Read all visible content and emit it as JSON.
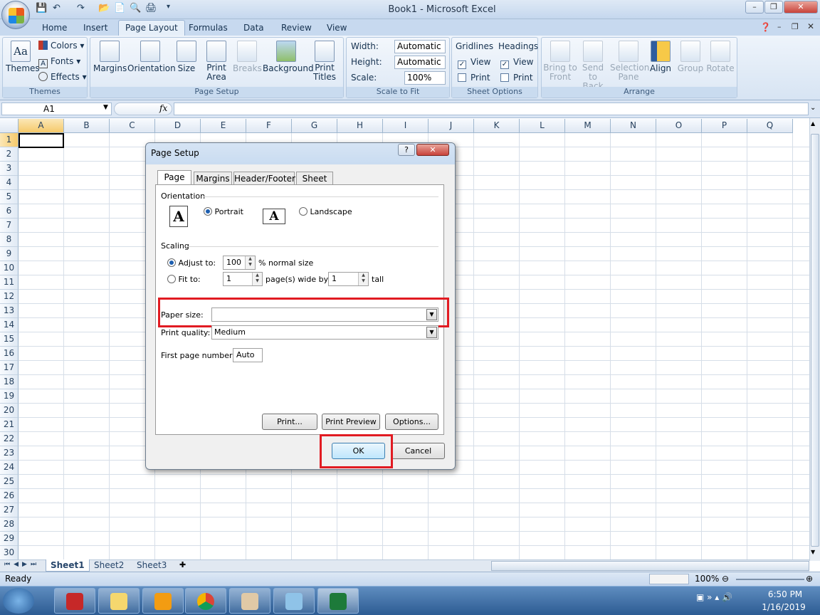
{
  "window": {
    "title": "Book1 - Microsoft Excel",
    "controls": {
      "minimize": "–",
      "restore": "❐",
      "close": "✕"
    }
  },
  "ribbon_tabs": [
    "Home",
    "Insert",
    "Page Layout",
    "Formulas",
    "Data",
    "Review",
    "View"
  ],
  "active_tab": "Page Layout",
  "ribbon": {
    "themes": {
      "themes_label": "Themes",
      "colors": "Colors",
      "fonts": "Fonts",
      "effects": "Effects",
      "group": "Themes"
    },
    "page_setup": {
      "margins": "Margins",
      "orientation": "Orientation",
      "size": "Size",
      "print_area_1": "Print",
      "print_area_2": "Area",
      "breaks": "Breaks",
      "background": "Background",
      "print_titles_1": "Print",
      "print_titles_2": "Titles",
      "group": "Page Setup"
    },
    "scale_to_fit": {
      "width_label": "Width:",
      "width_value": "Automatic",
      "height_label": "Height:",
      "height_value": "Automatic",
      "scale_label": "Scale:",
      "scale_value": "100%",
      "group": "Scale to Fit"
    },
    "sheet_options": {
      "gridlines": "Gridlines",
      "headings": "Headings",
      "view": "View",
      "print": "Print",
      "group": "Sheet Options"
    },
    "arrange": {
      "bring_1": "Bring to",
      "bring_2": "Front",
      "send_1": "Send to",
      "send_2": "Back",
      "selection_1": "Selection",
      "selection_2": "Pane",
      "align": "Align",
      "group_btn": "Group",
      "rotate": "Rotate",
      "group": "Arrange"
    }
  },
  "formula_bar": {
    "name_box": "A1",
    "fx": "fx"
  },
  "columns": [
    "A",
    "B",
    "C",
    "D",
    "E",
    "F",
    "G",
    "H",
    "I",
    "J",
    "K",
    "L",
    "M",
    "N",
    "O",
    "P",
    "Q"
  ],
  "rows": [
    "1",
    "2",
    "3",
    "4",
    "5",
    "6",
    "7",
    "8",
    "9",
    "10",
    "11",
    "12",
    "13",
    "14",
    "15",
    "16",
    "17",
    "18",
    "19",
    "20",
    "21",
    "22",
    "23",
    "24",
    "25",
    "26",
    "27",
    "28",
    "29",
    "30"
  ],
  "sheets": [
    "Sheet1",
    "Sheet2",
    "Sheet3"
  ],
  "status": {
    "ready": "Ready",
    "zoom": "100%"
  },
  "taskbar": {
    "time": "6:50 PM",
    "date": "1/16/2019"
  },
  "dialog": {
    "title": "Page Setup",
    "help": "?",
    "close": "✕",
    "tabs": [
      "Page",
      "Margins",
      "Header/Footer",
      "Sheet"
    ],
    "orientation_label": "Orientation",
    "portrait": "Portrait",
    "landscape": "Landscape",
    "scaling_label": "Scaling",
    "adjust_to": "Adjust to:",
    "adjust_value": "100",
    "normal_size": "% normal size",
    "fit_to": "Fit to:",
    "fit_wide_value": "1",
    "pages_wide_by": "page(s) wide by",
    "fit_tall_value": "1",
    "tall": "tall",
    "paper_size_label": "Paper size:",
    "paper_size_value": "",
    "print_quality_label": "Print quality:",
    "print_quality_value": "Medium",
    "first_page_label": "First page number:",
    "first_page_value": "Auto",
    "print_btn": "Print...",
    "print_preview_btn": "Print Preview",
    "options_btn": "Options...",
    "ok_btn": "OK",
    "cancel_btn": "Cancel"
  },
  "colors": {
    "highlight": "#e11b22",
    "ribbon": "#dbe6f4",
    "selected_col": "#f9d99b"
  }
}
